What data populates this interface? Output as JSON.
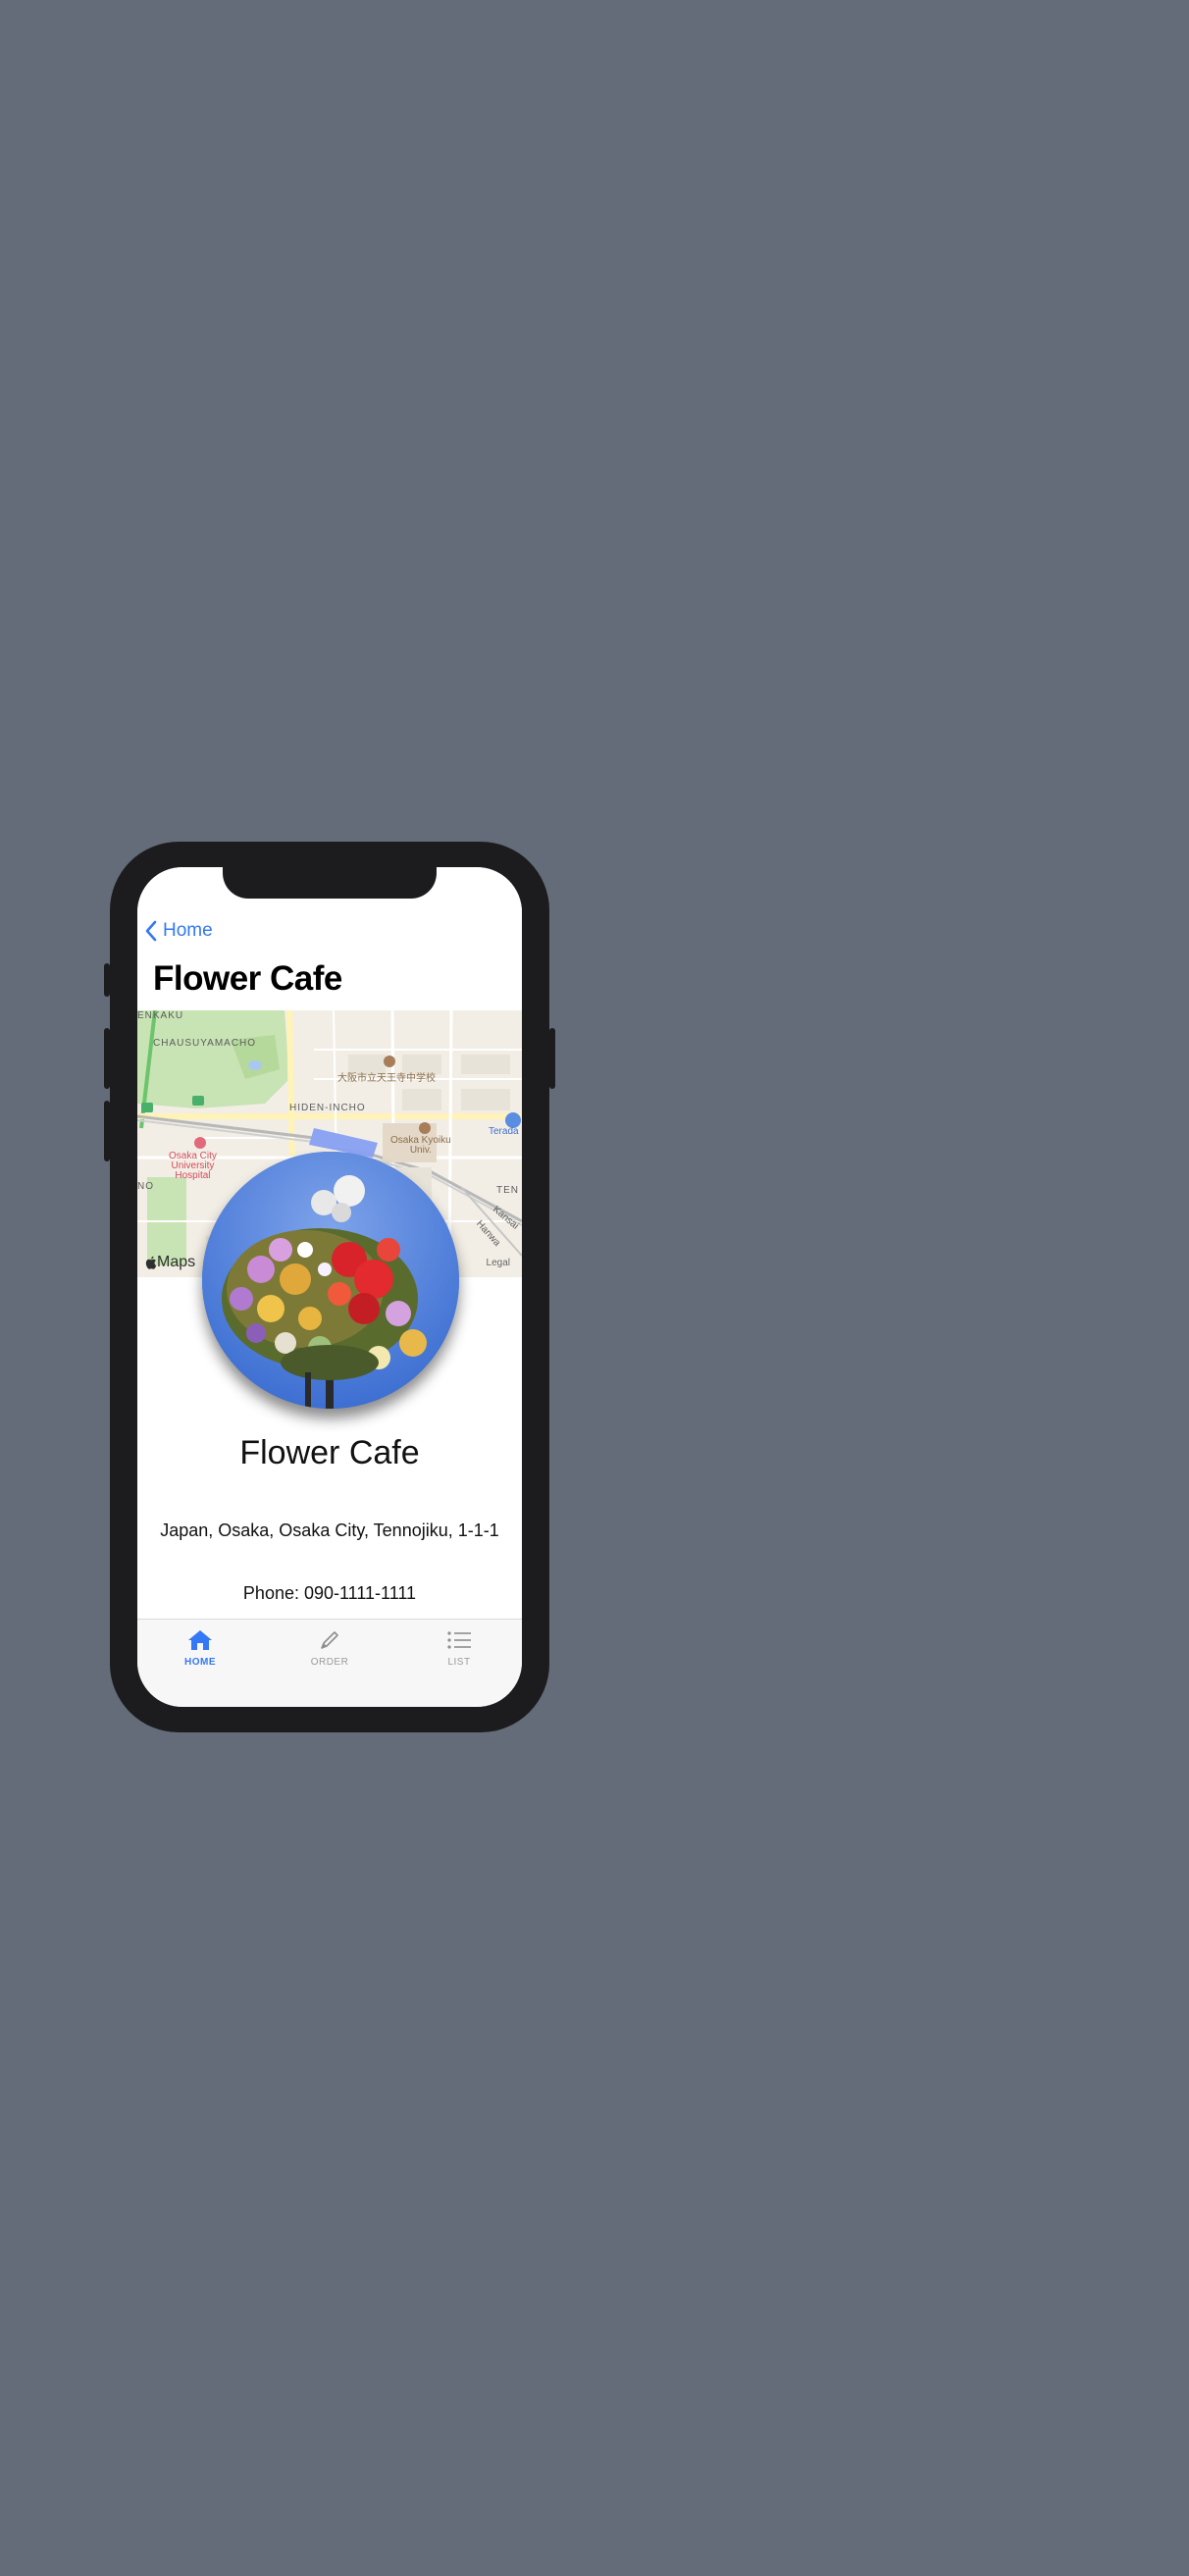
{
  "nav": {
    "back_label": "Home",
    "title": "Flower Cafe"
  },
  "map": {
    "labels": {
      "enkaku": "ENKAKU",
      "chausuyamacho": "CHAUSUYAMACHO",
      "school": "大阪市立天王寺中学校",
      "hiden_incho": "HIDEN-INCHO",
      "hospital": "Osaka City\nUniversity\nHospital",
      "kyoiku": "Osaka Kyoiku\nUniv.",
      "tera": "Terada",
      "no": "NO",
      "ten": "TEN",
      "kansai": "Kansai",
      "hanwa": "Hanwa"
    },
    "attribution": "Maps",
    "legal": "Legal"
  },
  "place": {
    "name": "Flower Cafe",
    "address": "Japan, Osaka, Osaka City, Tennojiku, 1-1-1",
    "phone": "Phone: 090-1111-1111"
  },
  "tabs": [
    {
      "label": "HOME",
      "icon": "house-icon",
      "active": true
    },
    {
      "label": "ORDER",
      "icon": "pencil-icon",
      "active": false
    },
    {
      "label": "LIST",
      "icon": "list-icon",
      "active": false
    }
  ],
  "colors": {
    "accent": "#3478f6",
    "background": "#636c78",
    "device": "#1c1c1e"
  }
}
